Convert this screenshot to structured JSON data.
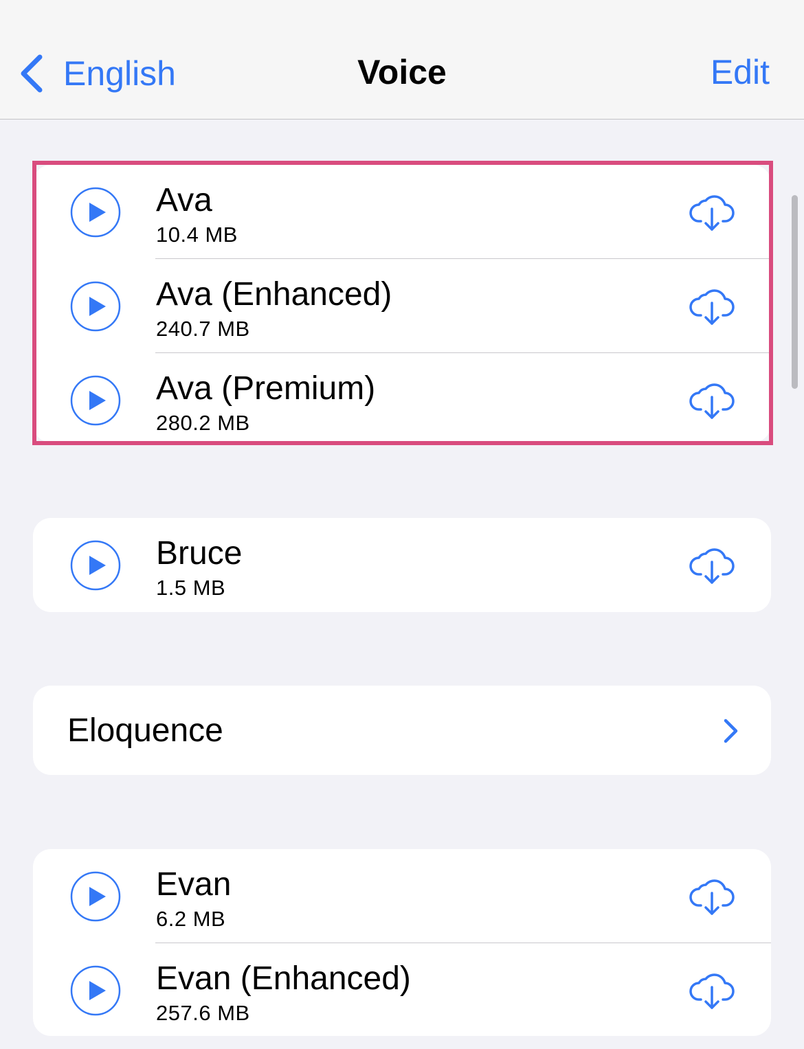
{
  "nav": {
    "back_label": "English",
    "title": "Voice",
    "edit_label": "Edit"
  },
  "groups": [
    {
      "highlighted": true,
      "voices": [
        {
          "name": "Ava",
          "size": "10.4 MB"
        },
        {
          "name": "Ava (Enhanced)",
          "size": "240.7 MB"
        },
        {
          "name": "Ava (Premium)",
          "size": "280.2 MB"
        }
      ]
    },
    {
      "voices": [
        {
          "name": "Bruce",
          "size": "1.5 MB"
        }
      ]
    },
    {
      "navigation_item": {
        "label": "Eloquence"
      }
    },
    {
      "voices": [
        {
          "name": "Evan",
          "size": "6.2 MB"
        },
        {
          "name": "Evan (Enhanced)",
          "size": "257.6 MB"
        }
      ]
    }
  ],
  "icons": {
    "back": "chevron-left-icon",
    "play": "play-circle-icon",
    "download": "cloud-download-icon",
    "disclosure": "chevron-right-icon"
  },
  "colors": {
    "accent": "#3478f6",
    "highlight_border": "#d94c7e",
    "background": "#f2f2f7",
    "cell": "#ffffff"
  }
}
